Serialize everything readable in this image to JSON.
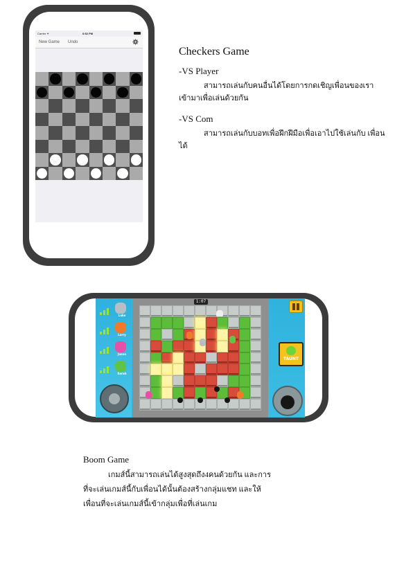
{
  "checkers": {
    "title": "Checkers Game",
    "vs_player_heading": "-VS Player",
    "vs_player_desc": "สามารถเล่นกับคนอื่นได้โดยการกดเชิญเพื่อนของเรา เข้ามาเพื่อเล่นด้วยกัน",
    "vs_com_heading": "-VS Com",
    "vs_com_desc": "สามารถเล่นกับบอทเพื่อฝึกฝีมือเพื่อเอาไปใช้เล่นกับ เพื่อนได้",
    "screen": {
      "carrier": "Carrier ✦",
      "time": "6:52 PM",
      "new_game_label": "New Game",
      "undo_label": "Undo",
      "settings_icon": "gear-icon"
    }
  },
  "boom": {
    "title": "Boom Game",
    "desc_line1": "เกมส์นี้สามารถเล่นได้สูงสุดถึง4คนด้วยกัน และการ",
    "desc_line2": "ที่จะเล่นเกมส์นี้กับเพื่อนได้นั้นต้องสร้างกลุ่มแชท และให้",
    "desc_line3": "เพื่อนที่จะเล่นเกมส์นี้เข้ากลุ่มเพื่อที่เล่นเกม",
    "screen": {
      "timer": "1:07",
      "taunt_label": "TAUNT",
      "players": [
        {
          "name": "Luke",
          "color": "#b9bdc4"
        },
        {
          "name": "Larry",
          "color": "#f07a2a"
        },
        {
          "name": "Jason",
          "color": "#e84fa7"
        },
        {
          "name": "Sarah",
          "color": "#5fc447"
        }
      ]
    }
  }
}
